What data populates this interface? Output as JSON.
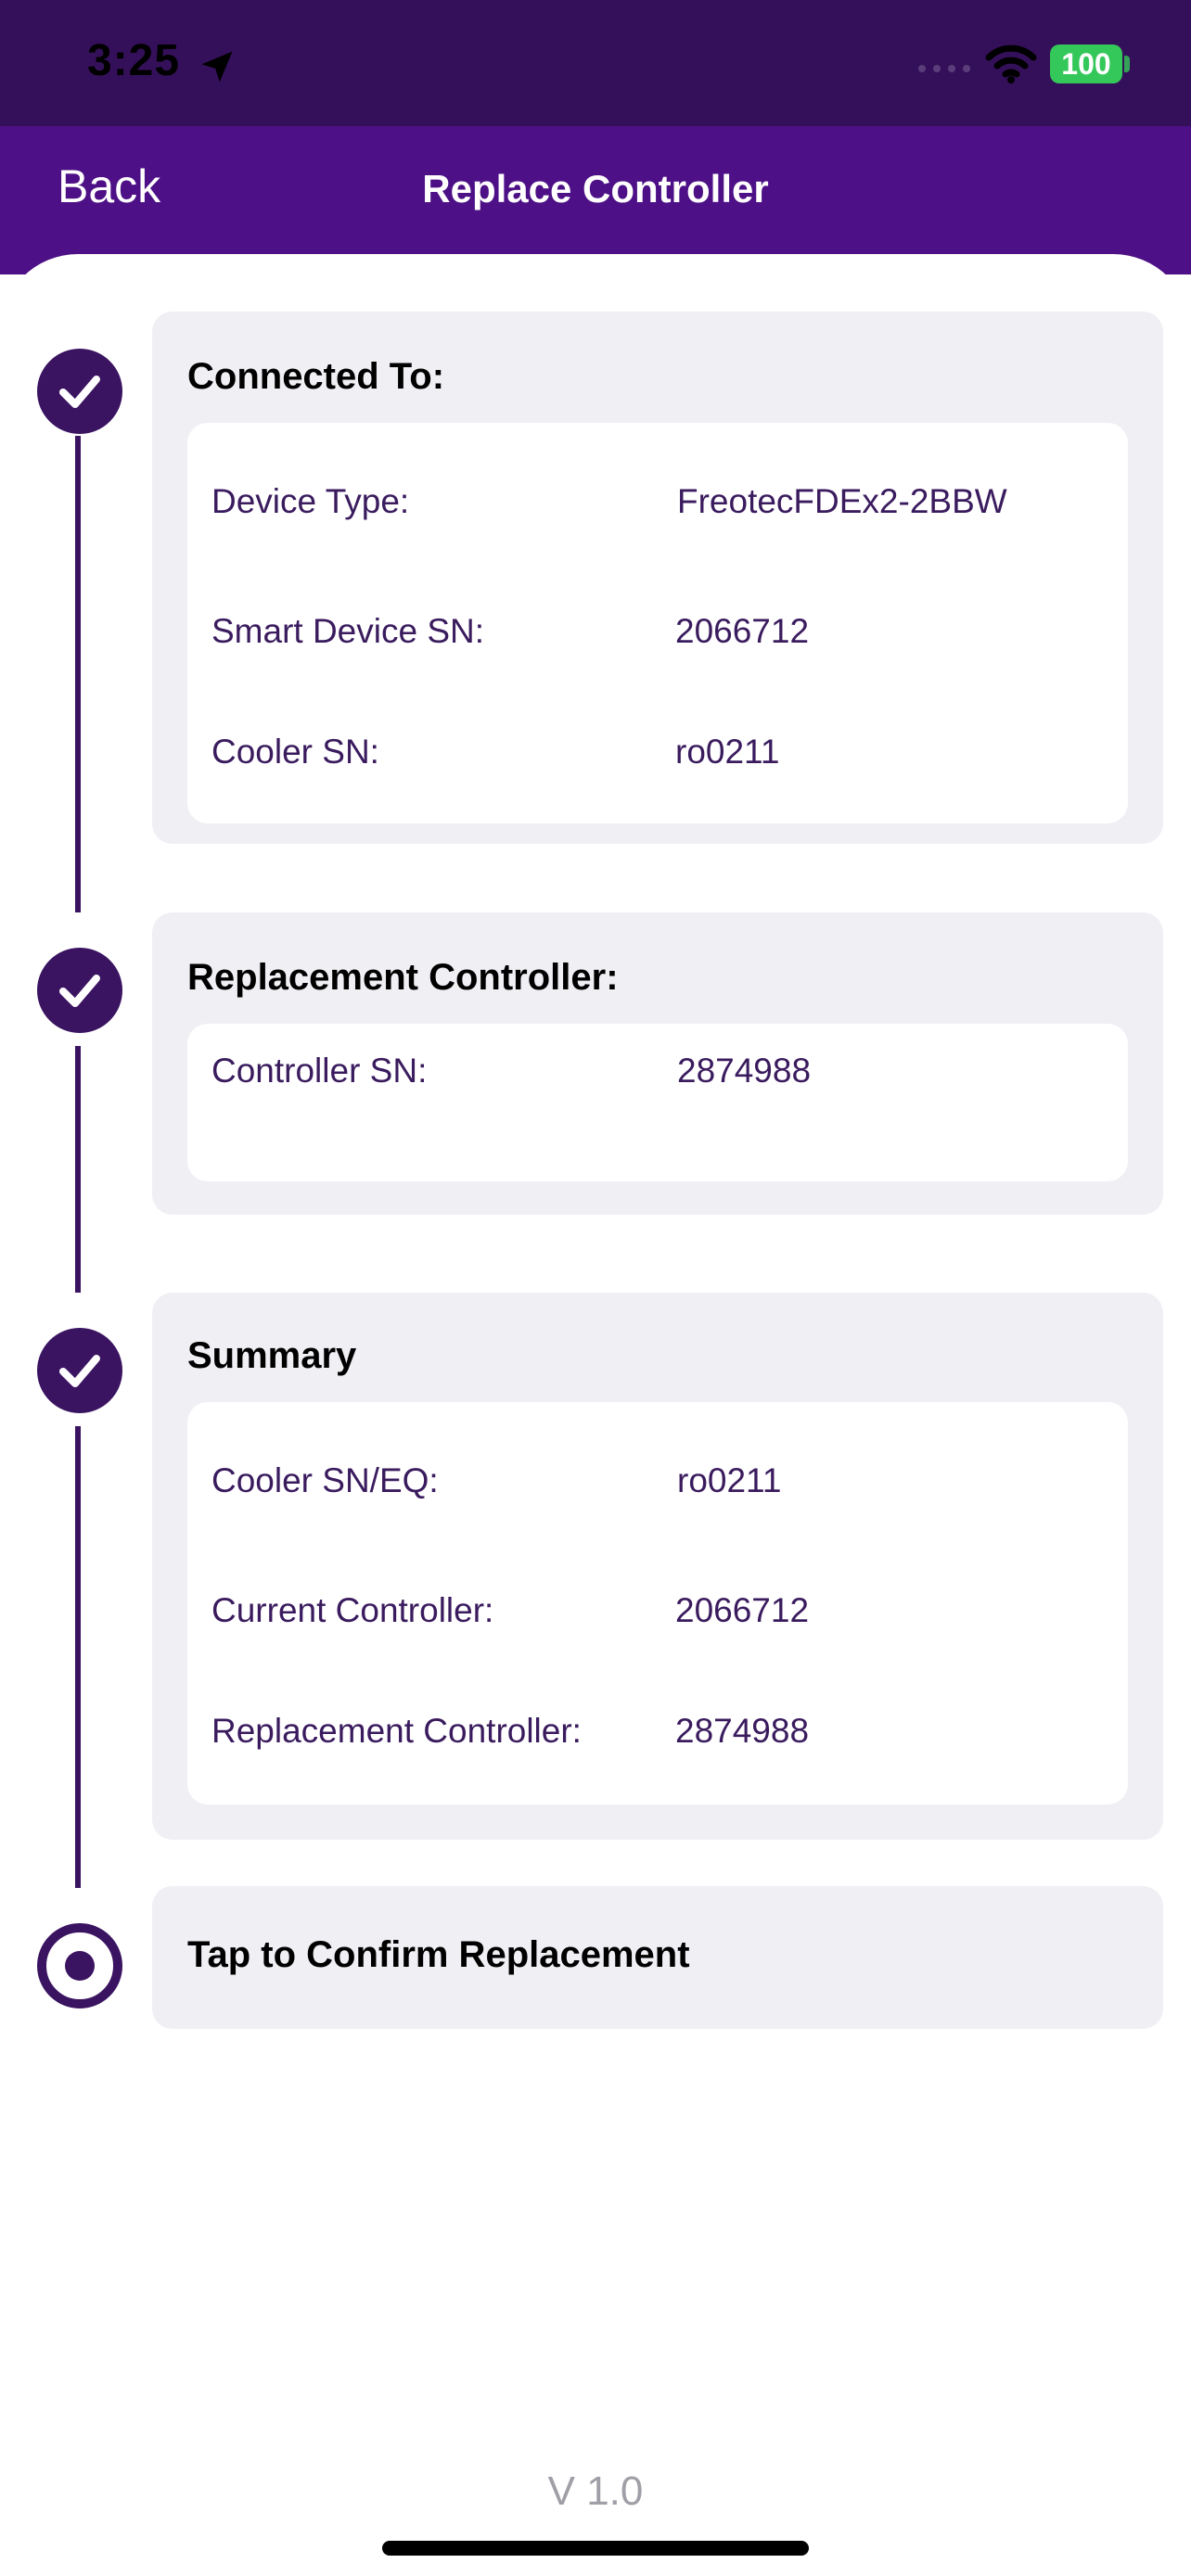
{
  "status_bar": {
    "time": "3:25",
    "battery": "100",
    "icons": [
      "location-arrow-icon",
      "signal-icon",
      "wifi-icon",
      "battery-icon"
    ]
  },
  "nav": {
    "back_label": "Back",
    "title": "Replace Controller"
  },
  "steps": {
    "connected": {
      "title": "Connected To:",
      "rows": [
        {
          "label": "Device Type:",
          "value": "FreotecFDEx2-2BBW"
        },
        {
          "label": "Smart Device SN:",
          "value": "2066712"
        },
        {
          "label": "Cooler SN:",
          "value": "ro0211"
        }
      ]
    },
    "replacement": {
      "title": "Replacement Controller:",
      "rows": [
        {
          "label": "Controller SN:",
          "value": "2874988"
        }
      ]
    },
    "summary": {
      "title": "Summary",
      "rows": [
        {
          "label": "Cooler SN/EQ:",
          "value": "ro0211"
        },
        {
          "label": "Current Controller:",
          "value": "2066712"
        },
        {
          "label": "Replacement Controller:",
          "value": "2874988"
        }
      ]
    },
    "confirm": {
      "title": "Tap to Confirm Replacement"
    }
  },
  "footer": {
    "version": "V 1.0"
  },
  "colors": {
    "status_bar_bg": "#35105a",
    "nav_bg": "#4d1086",
    "accent": "#3a1361",
    "card_bg": "#f0eff4"
  }
}
